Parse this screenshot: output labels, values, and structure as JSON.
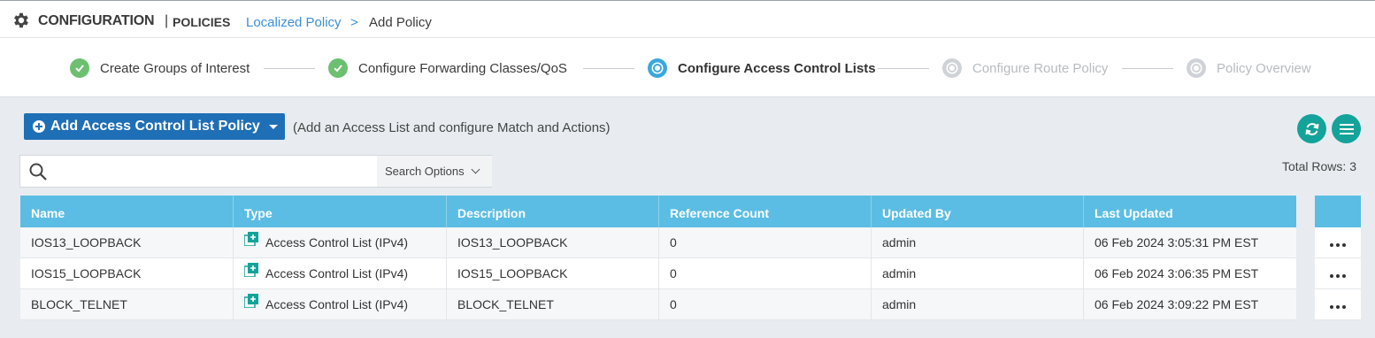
{
  "header": {
    "title": "CONFIGURATION",
    "separator": "|",
    "subtitle": "POLICIES",
    "breadcrumb_link": "Localized Policy",
    "breadcrumb_separator": ">",
    "breadcrumb_current": "Add Policy"
  },
  "wizard": {
    "steps": [
      {
        "label": "Create Groups of Interest",
        "state": "done"
      },
      {
        "label": "Configure Forwarding Classes/QoS",
        "state": "done"
      },
      {
        "label": "Configure Access Control Lists",
        "state": "active"
      },
      {
        "label": "Configure Route Policy",
        "state": "pending"
      },
      {
        "label": "Policy Overview",
        "state": "pending"
      }
    ]
  },
  "toolbar": {
    "add_button_label": "Add Access Control List Policy",
    "add_hint": "(Add an Access List and configure Match and Actions)",
    "refresh_icon": "refresh-icon",
    "menu_icon": "list-menu-icon"
  },
  "search": {
    "value": "",
    "placeholder": "",
    "options_label": "Search Options"
  },
  "total_rows_text": "Total Rows: 3",
  "table": {
    "columns": [
      "Name",
      "Type",
      "Description",
      "Reference Count",
      "Updated By",
      "Last Updated"
    ],
    "rows": [
      {
        "name": "IOS13_LOOPBACK",
        "type": "Access Control List (IPv4)",
        "description": "IOS13_LOOPBACK",
        "reference_count": "0",
        "updated_by": "admin",
        "last_updated": "06 Feb 2024 3:05:31 PM EST"
      },
      {
        "name": "IOS15_LOOPBACK",
        "type": "Access Control List (IPv4)",
        "description": "IOS15_LOOPBACK",
        "reference_count": "0",
        "updated_by": "admin",
        "last_updated": "06 Feb 2024 3:06:35 PM EST"
      },
      {
        "name": "BLOCK_TELNET",
        "type": "Access Control List (IPv4)",
        "description": "BLOCK_TELNET",
        "reference_count": "0",
        "updated_by": "admin",
        "last_updated": "06 Feb 2024 3:09:22 PM EST"
      }
    ]
  },
  "colors": {
    "accent_blue": "#1f6fb6",
    "table_header": "#5bbde3",
    "step_done": "#6cc070",
    "step_active": "#39a8dc",
    "teal_button": "#14a39a",
    "link": "#3b8ed8"
  }
}
